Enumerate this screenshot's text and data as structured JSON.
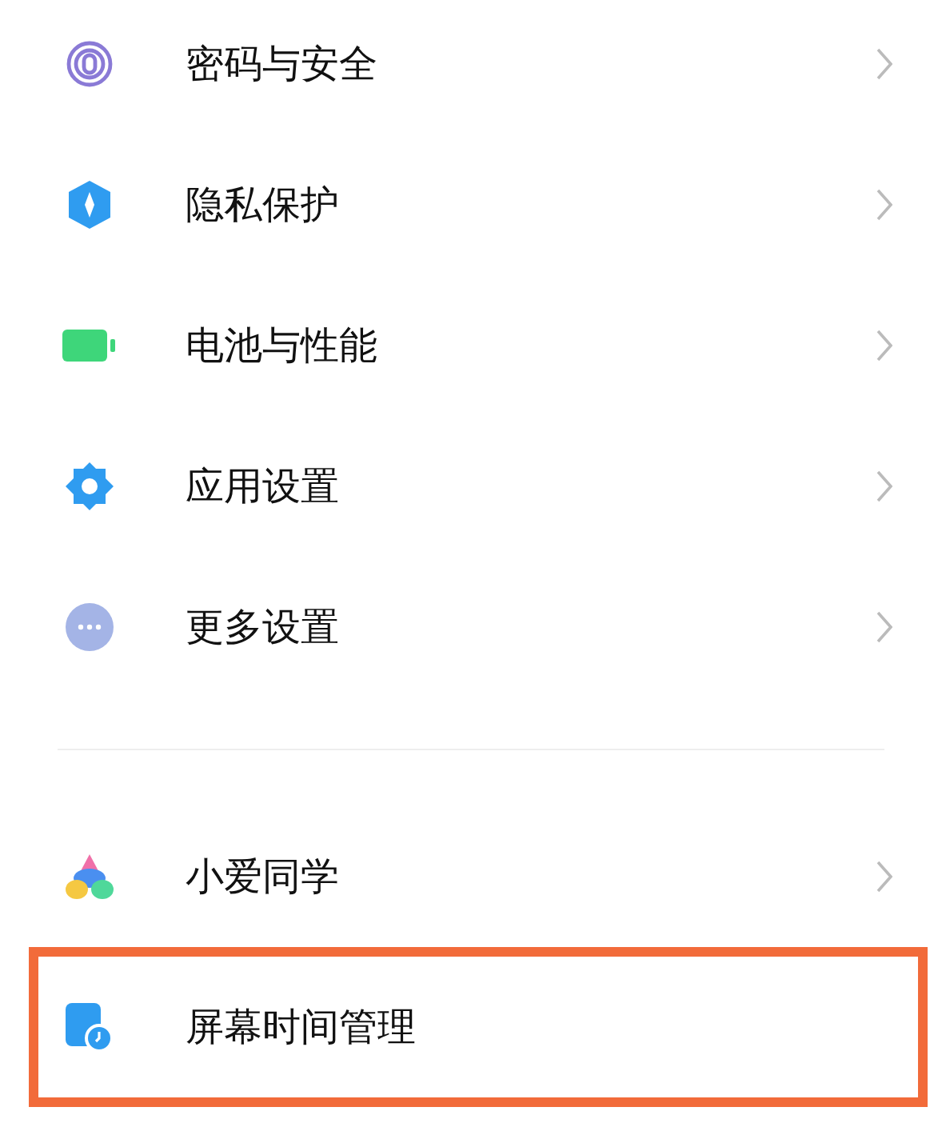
{
  "sections": [
    {
      "highlighted": false,
      "items": [
        {
          "kind": "fingerprint",
          "label": "密码与安全",
          "chevron": true
        },
        {
          "kind": "shield",
          "label": "隐私保护",
          "chevron": true
        },
        {
          "kind": "battery",
          "label": "电池与性能",
          "chevron": true
        },
        {
          "kind": "gear",
          "label": "应用设置",
          "chevron": true
        },
        {
          "kind": "more",
          "label": "更多设置",
          "chevron": true
        }
      ]
    },
    {
      "highlighted": false,
      "items": [
        {
          "kind": "assistant",
          "label": "小爱同学",
          "chevron": true
        }
      ]
    },
    {
      "highlighted": true,
      "items": [
        {
          "kind": "screentime",
          "label": "屏幕时间管理",
          "chevron": false
        }
      ]
    }
  ]
}
